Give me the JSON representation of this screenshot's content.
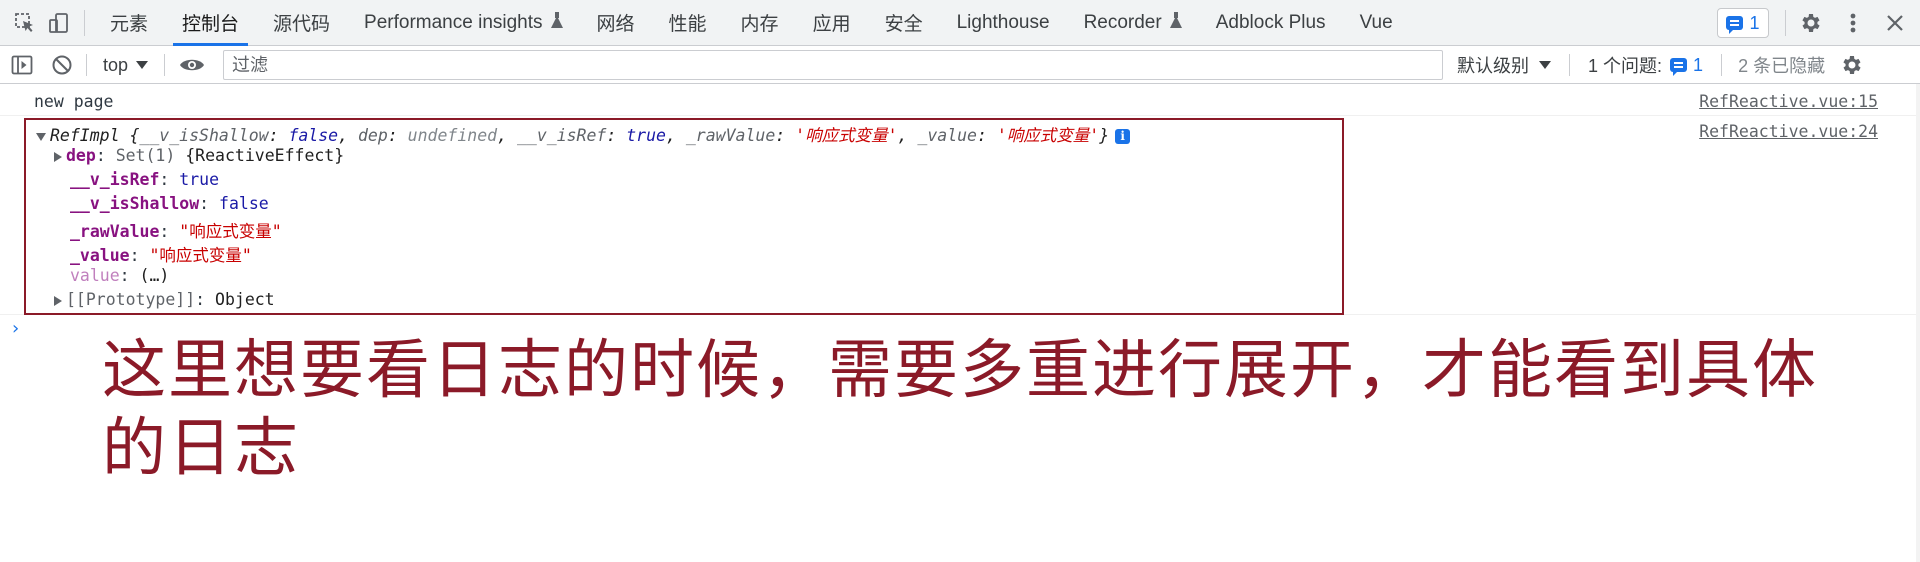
{
  "tabs": [
    {
      "label": "元素",
      "active": false,
      "experimental": false
    },
    {
      "label": "控制台",
      "active": true,
      "experimental": false
    },
    {
      "label": "源代码",
      "active": false,
      "experimental": false
    },
    {
      "label": "Performance insights",
      "active": false,
      "experimental": true
    },
    {
      "label": "网络",
      "active": false,
      "experimental": false
    },
    {
      "label": "性能",
      "active": false,
      "experimental": false
    },
    {
      "label": "内存",
      "active": false,
      "experimental": false
    },
    {
      "label": "应用",
      "active": false,
      "experimental": false
    },
    {
      "label": "安全",
      "active": false,
      "experimental": false
    },
    {
      "label": "Lighthouse",
      "active": false,
      "experimental": false
    },
    {
      "label": "Recorder",
      "active": false,
      "experimental": true
    },
    {
      "label": "Adblock Plus",
      "active": false,
      "experimental": false
    },
    {
      "label": "Vue",
      "active": false,
      "experimental": false
    }
  ],
  "tabbar_right": {
    "issues_badge_count": "1",
    "icons": [
      "gear-icon",
      "kebab-menu-icon",
      "close-icon"
    ]
  },
  "toolbar": {
    "context": "top",
    "filter_placeholder": "过滤",
    "level": "默认级别",
    "issues_label": "1 个问题:",
    "issues_count": "1",
    "hidden_label": "2 条已隐藏"
  },
  "console": {
    "log_message": "new page",
    "log_source": "RefReactive.vue:15",
    "object_source": "RefReactive.vue:24",
    "object_summary": {
      "class_name": "RefImpl",
      "k1": "__v_isShallow",
      "v1": "false",
      "k2": "dep",
      "v2": "undefined",
      "k3": "__v_isRef",
      "v3": "true",
      "k4": "_rawValue",
      "v4": "'响应式变量'",
      "k5": "_value",
      "v5": "'响应式变量'"
    },
    "properties": {
      "dep_key": "dep",
      "dep_value": "Set(1)",
      "dep_extra": "{ReactiveEffect}",
      "isref_key": "__v_isRef",
      "isref_value": "true",
      "isshallow_key": "__v_isShallow",
      "isshallow_value": "false",
      "rawvalue_key": "_rawValue",
      "rawvalue_value": "\"响应式变量\"",
      "value_key": "_value",
      "value_value": "\"响应式变量\"",
      "getter_key": "value",
      "getter_value": "(…)",
      "proto_key": "[[Prototype]]",
      "proto_value": "Object"
    }
  },
  "annotation": {
    "text": "这里想要看日志的时候，需要多重进行展开，才能看到具体的日志",
    "color": "#8b1a28"
  },
  "colors": {
    "accent": "#1a73e8",
    "annotation_box": "#8b1a28",
    "string_value": "#c80000",
    "keyword_value": "#1a1aa6",
    "property_key": "#881280"
  }
}
